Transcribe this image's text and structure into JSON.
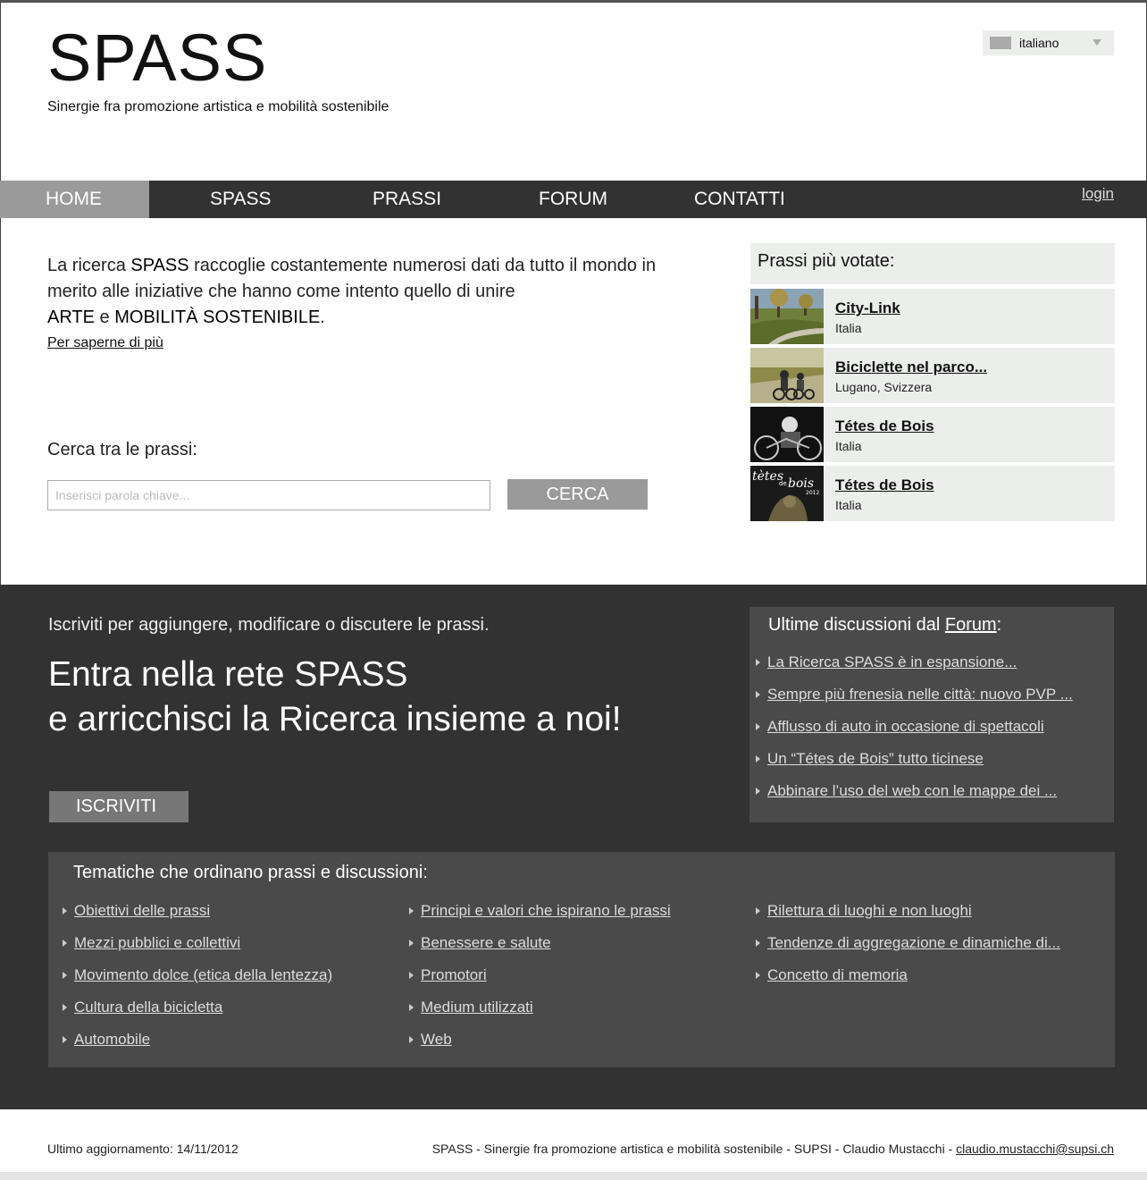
{
  "header": {
    "title": "SPASS",
    "subtitle": "Sinergie fra promozione artistica e mobilità sostenibile",
    "language": "italiano"
  },
  "nav": {
    "items": [
      "HOME",
      "SPASS",
      "PRASSI",
      "FORUM",
      "CONTATTI"
    ],
    "active": "HOME",
    "login": "login"
  },
  "intro": {
    "part1": "La ricerca ",
    "spass": "SPASS",
    "part2": " raccoglie costantemente numerosi dati da tutto il mondo in merito alle iniziative che hanno come intento quello di unire ",
    "arte": "ARTE",
    "part3": " e ",
    "mobilita": "MOBILITÀ SOSTENIBILE",
    "part4": ".",
    "more_link": "Per saperne di più"
  },
  "search": {
    "label": "Cerca tra le prassi:",
    "placeholder": "Inserisci parola chiave...",
    "button": "CERCA"
  },
  "voted": {
    "title": "Prassi più votate:",
    "items": [
      {
        "name": "City-Link",
        "place": "Italia"
      },
      {
        "name": "Biciclette nel parco...",
        "place": "Lugano, Svizzera"
      },
      {
        "name": "Tétes de Bois",
        "place": "Italia"
      },
      {
        "name": "Tétes de Bois",
        "place": "Italia"
      }
    ],
    "thumb4_text1": "tètes",
    "thumb4_text2": "de",
    "thumb4_text3": "bois",
    "thumb4_year": "2012"
  },
  "signup": {
    "lead": "Iscriviti per aggiungere, modificare o discutere le prassi.",
    "heading_line1": "Entra nella rete SPASS",
    "heading_line2": "e arricchisci la Ricerca insieme a noi!",
    "button": "ISCRIVITI"
  },
  "forum": {
    "title_prefix": "Ultime discussioni dal ",
    "title_link": "Forum",
    "title_suffix": ":",
    "items": [
      "La Ricerca SPASS è in espansione...",
      "Sempre più frenesia nelle città: nuovo PVP ...",
      "Afflusso di auto in occasione di spettacoli",
      "Un “Tétes de Bois” tutto ticinese",
      "Abbinare l’uso del web con le mappe dei ..."
    ]
  },
  "topics": {
    "title": "Tematiche che ordinano prassi e discussioni:",
    "col1": [
      "Obiettivi delle prassi",
      "Mezzi pubblici e collettivi",
      "Movimento dolce (etica della lentezza)",
      "Cultura della bicicletta",
      "Automobile"
    ],
    "col2": [
      "Principi e valori che ispirano le prassi",
      "Benessere e salute",
      "Promotori",
      "Medium utilizzati",
      "Web"
    ],
    "col3": [
      "Rilettura di luoghi e non luoghi",
      "Tendenze di aggregazione e dinamiche di...",
      "Concetto di memoria"
    ]
  },
  "footer": {
    "updated": "Ultimo aggiornamento: 14/11/2012",
    "credits": "SPASS - Sinergie fra promozione artistica e mobilità sostenibile - SUPSI - Claudio Mustacchi - ",
    "email": "claudio.mustacchi@supsi.ch"
  }
}
